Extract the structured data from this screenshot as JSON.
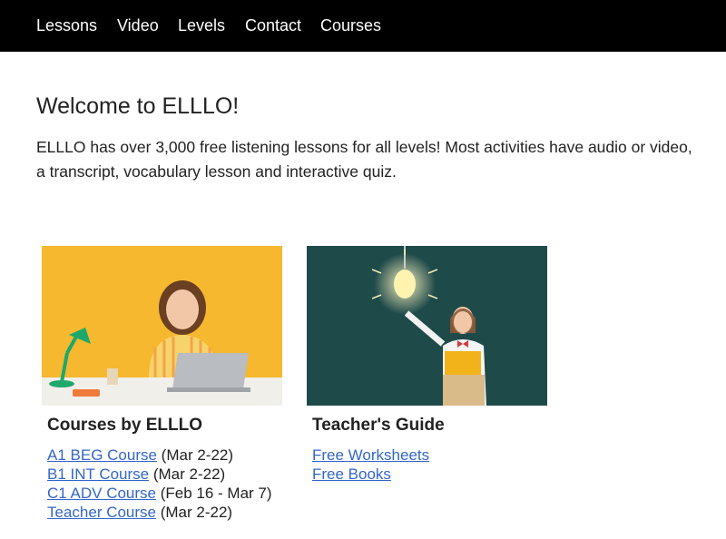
{
  "nav": {
    "items": [
      {
        "label": "Lessons"
      },
      {
        "label": "Video"
      },
      {
        "label": "Levels"
      },
      {
        "label": "Contact"
      },
      {
        "label": "Courses"
      }
    ]
  },
  "main": {
    "title": "Welcome to ELLLO!",
    "intro": "ELLLO has over 3,000 free listening lessons for all levels! Most activities have audio or video, a transcript, vocabulary lesson and interactive quiz."
  },
  "cards": [
    {
      "title": "Courses by ELLLO",
      "image": "woman-laptop-yellow-photo",
      "links": [
        {
          "label": "A1 BEG Course",
          "note": " (Mar 2-22)"
        },
        {
          "label": "B1 INT Course",
          "note": " (Mar 2-22)"
        },
        {
          "label": "C1 ADV Course",
          "note": " (Feb 16 - Mar 7)"
        },
        {
          "label": "Teacher Course",
          "note": " (Mar 2-22)"
        }
      ]
    },
    {
      "title": "Teacher's Guide",
      "image": "teacher-lightbulb-photo",
      "links": [
        {
          "label": "Free Worksheets",
          "note": ""
        },
        {
          "label": "Free Books",
          "note": ""
        }
      ]
    }
  ],
  "colors": {
    "nav_bg": "#000000",
    "link": "#3366cc",
    "photo1_bg": "#f5b82e",
    "photo2_bg": "#1f4a4a"
  }
}
